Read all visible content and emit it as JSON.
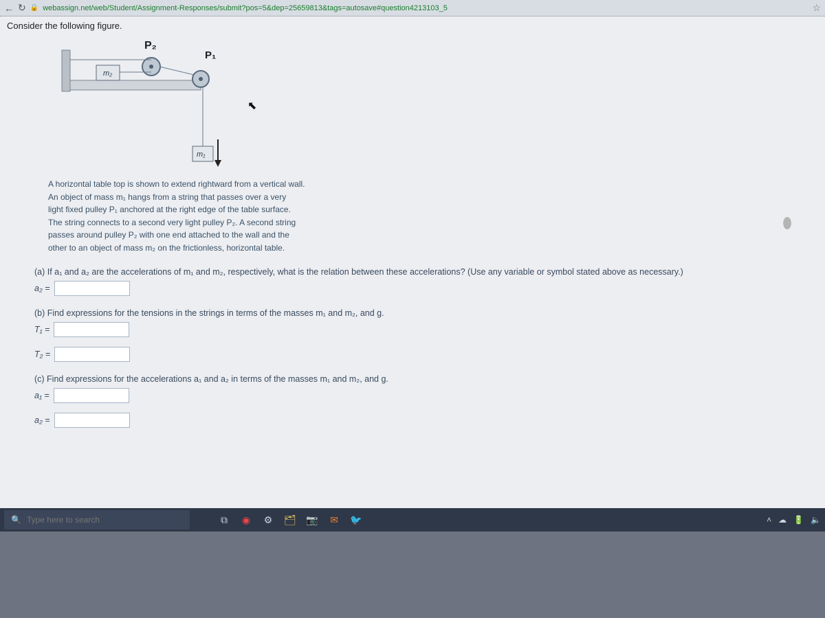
{
  "addressbar": {
    "url": "webassign.net/web/Student/Assignment-Responses/submit?pos=5&dep=25659813&tags=autosave#question4213103_5"
  },
  "prompt": "Consider the following figure.",
  "figure": {
    "label_P2": "P₂",
    "label_P1": "P₁",
    "label_m2": "m₂",
    "label_m1": "m₁"
  },
  "description": {
    "l1": "A horizontal table top is shown to extend rightward from a vertical wall.",
    "l2": "An object of mass m₁ hangs from a string that passes over a very",
    "l3": "light fixed pulley P₁ anchored at the right edge of the table surface.",
    "l4": "The string connects to a second very light pulley P₂. A second string",
    "l5": "passes around pulley P₂ with one end attached to the wall and the",
    "l6": "other to an object of mass m₂ on the frictionless, horizontal table."
  },
  "parts": {
    "a_text": "(a) If a₁ and a₂ are the accelerations of m₁ and m₂, respectively, what is the relation between these accelerations? (Use any variable or symbol stated above as necessary.)",
    "a_lbl": "a₂ =",
    "b_text": "(b) Find expressions for the tensions in the strings in terms of the masses m₁ and m₂, and g.",
    "b_lbl1": "T₁ =",
    "b_lbl2": "T₂ =",
    "c_text": "(c) Find expressions for the accelerations a₁ and a₂ in terms of the masses m₁ and m₂, and g.",
    "c_lbl1": "a₁ =",
    "c_lbl2": "a₂ ="
  },
  "taskbar": {
    "search_placeholder": "Type here to search"
  }
}
